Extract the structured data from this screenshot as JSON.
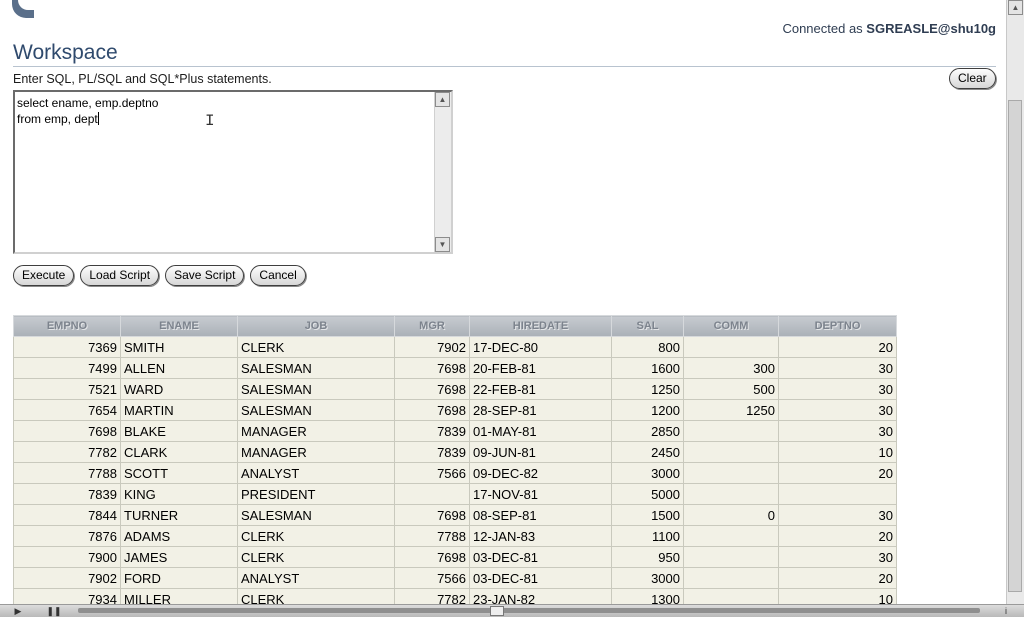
{
  "header": {
    "connected_prefix": "Connected as ",
    "connected_user": "SGREASLE@shu10g"
  },
  "workspace": {
    "title": "Workspace",
    "instructions": "Enter SQL, PL/SQL and SQL*Plus statements.",
    "clear_label": "Clear",
    "sql_line1": "select ename, emp.deptno",
    "sql_line2": "from emp, dept"
  },
  "actions": {
    "execute": "Execute",
    "load_script": "Load Script",
    "save_script": "Save Script",
    "cancel": "Cancel"
  },
  "results": {
    "columns": [
      "EMPNO",
      "ENAME",
      "JOB",
      "MGR",
      "HIREDATE",
      "SAL",
      "COMM",
      "DEPTNO"
    ],
    "rows": [
      [
        "7369",
        "SMITH",
        "CLERK",
        "7902",
        "17-DEC-80",
        "800",
        "",
        "20"
      ],
      [
        "7499",
        "ALLEN",
        "SALESMAN",
        "7698",
        "20-FEB-81",
        "1600",
        "300",
        "30"
      ],
      [
        "7521",
        "WARD",
        "SALESMAN",
        "7698",
        "22-FEB-81",
        "1250",
        "500",
        "30"
      ],
      [
        "7654",
        "MARTIN",
        "SALESMAN",
        "7698",
        "28-SEP-81",
        "1200",
        "1250",
        "30"
      ],
      [
        "7698",
        "BLAKE",
        "MANAGER",
        "7839",
        "01-MAY-81",
        "2850",
        "",
        "30"
      ],
      [
        "7782",
        "CLARK",
        "MANAGER",
        "7839",
        "09-JUN-81",
        "2450",
        "",
        "10"
      ],
      [
        "7788",
        "SCOTT",
        "ANALYST",
        "7566",
        "09-DEC-82",
        "3000",
        "",
        "20"
      ],
      [
        "7839",
        "KING",
        "PRESIDENT",
        "",
        "17-NOV-81",
        "5000",
        "",
        ""
      ],
      [
        "7844",
        "TURNER",
        "SALESMAN",
        "7698",
        "08-SEP-81",
        "1500",
        "0",
        "30"
      ],
      [
        "7876",
        "ADAMS",
        "CLERK",
        "7788",
        "12-JAN-83",
        "1100",
        "",
        "20"
      ],
      [
        "7900",
        "JAMES",
        "CLERK",
        "7698",
        "03-DEC-81",
        "950",
        "",
        "30"
      ],
      [
        "7902",
        "FORD",
        "ANALYST",
        "7566",
        "03-DEC-81",
        "3000",
        "",
        "20"
      ],
      [
        "7934",
        "MILLER",
        "CLERK",
        "7782",
        "23-JAN-82",
        "1300",
        "",
        "10"
      ]
    ]
  },
  "player": {
    "play_icon": "play-icon",
    "pause_icon": "pause-icon",
    "info_icon": "info-icon"
  }
}
